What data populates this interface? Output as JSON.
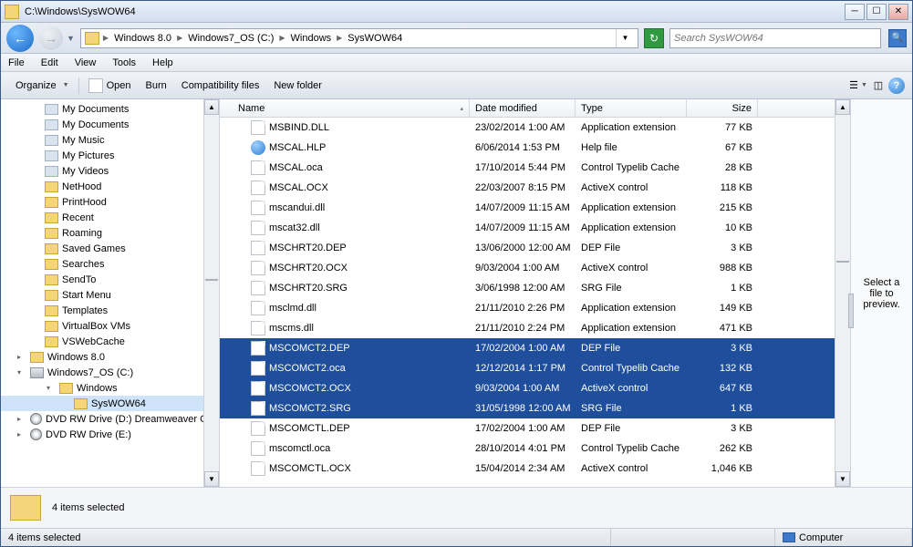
{
  "window": {
    "title": "C:\\Windows\\SysWOW64"
  },
  "breadcrumbs": [
    "Windows 8.0",
    "Windows7_OS (C:)",
    "Windows",
    "SysWOW64"
  ],
  "search": {
    "placeholder": "Search SysWOW64"
  },
  "menus": [
    "File",
    "Edit",
    "View",
    "Tools",
    "Help"
  ],
  "commandbar": {
    "organize": "Organize",
    "open": "Open",
    "burn": "Burn",
    "compat": "Compatibility files",
    "newfolder": "New folder"
  },
  "columns": {
    "name": "Name",
    "date": "Date modified",
    "type": "Type",
    "size": "Size"
  },
  "tree": [
    {
      "l": 2,
      "icon": "doc",
      "label": "My Documents"
    },
    {
      "l": 2,
      "icon": "doc",
      "label": "My Documents"
    },
    {
      "l": 2,
      "icon": "doc",
      "label": "My Music"
    },
    {
      "l": 2,
      "icon": "doc",
      "label": "My Pictures"
    },
    {
      "l": 2,
      "icon": "doc",
      "label": "My Videos"
    },
    {
      "l": 2,
      "icon": "folder",
      "label": "NetHood"
    },
    {
      "l": 2,
      "icon": "folder",
      "label": "PrintHood"
    },
    {
      "l": 2,
      "icon": "folder",
      "label": "Recent"
    },
    {
      "l": 2,
      "icon": "folder",
      "label": "Roaming"
    },
    {
      "l": 2,
      "icon": "folder",
      "label": "Saved Games"
    },
    {
      "l": 2,
      "icon": "folder",
      "label": "Searches"
    },
    {
      "l": 2,
      "icon": "folder",
      "label": "SendTo"
    },
    {
      "l": 2,
      "icon": "folder",
      "label": "Start Menu"
    },
    {
      "l": 2,
      "icon": "folder",
      "label": "Templates"
    },
    {
      "l": 2,
      "icon": "folder",
      "label": "VirtualBox VMs"
    },
    {
      "l": 2,
      "icon": "folder",
      "label": "VSWebCache"
    },
    {
      "l": 1,
      "icon": "folder",
      "label": "Windows 8.0",
      "expand": "▸"
    },
    {
      "l": 1,
      "icon": "drive",
      "label": "Windows7_OS (C:)",
      "expand": "▾"
    },
    {
      "l": 3,
      "icon": "folder",
      "label": "Windows",
      "expand": "▾"
    },
    {
      "l": 4,
      "icon": "folder",
      "label": "SysWOW64",
      "sel": true
    },
    {
      "l": 1,
      "icon": "dvd",
      "label": "DVD RW Drive (D:) Dreamweaver CS",
      "expand": "▸"
    },
    {
      "l": 1,
      "icon": "dvd",
      "label": "DVD RW Drive (E:)",
      "expand": "▸"
    }
  ],
  "files": [
    {
      "name": "MSBIND.DLL",
      "date": "23/02/2014 1:00 AM",
      "type": "Application extension",
      "size": "77 KB",
      "icon": "file"
    },
    {
      "name": "MSCAL.HLP",
      "date": "6/06/2014 1:53 PM",
      "type": "Help file",
      "size": "67 KB",
      "icon": "help"
    },
    {
      "name": "MSCAL.oca",
      "date": "17/10/2014 5:44 PM",
      "type": "Control Typelib Cache",
      "size": "28 KB",
      "icon": "file"
    },
    {
      "name": "MSCAL.OCX",
      "date": "22/03/2007 8:15 PM",
      "type": "ActiveX control",
      "size": "118 KB",
      "icon": "file"
    },
    {
      "name": "mscandui.dll",
      "date": "14/07/2009 11:15 AM",
      "type": "Application extension",
      "size": "215 KB",
      "icon": "file"
    },
    {
      "name": "mscat32.dll",
      "date": "14/07/2009 11:15 AM",
      "type": "Application extension",
      "size": "10 KB",
      "icon": "file"
    },
    {
      "name": "MSCHRT20.DEP",
      "date": "13/06/2000 12:00 AM",
      "type": "DEP File",
      "size": "3 KB",
      "icon": "file"
    },
    {
      "name": "MSCHRT20.OCX",
      "date": "9/03/2004 1:00 AM",
      "type": "ActiveX control",
      "size": "988 KB",
      "icon": "file"
    },
    {
      "name": "MSCHRT20.SRG",
      "date": "3/06/1998 12:00 AM",
      "type": "SRG File",
      "size": "1 KB",
      "icon": "file"
    },
    {
      "name": "msclmd.dll",
      "date": "21/11/2010 2:26 PM",
      "type": "Application extension",
      "size": "149 KB",
      "icon": "file"
    },
    {
      "name": "mscms.dll",
      "date": "21/11/2010 2:24 PM",
      "type": "Application extension",
      "size": "471 KB",
      "icon": "file"
    },
    {
      "name": "MSCOMCT2.DEP",
      "date": "17/02/2004 1:00 AM",
      "type": "DEP File",
      "size": "3 KB",
      "icon": "file",
      "sel": true
    },
    {
      "name": "MSCOMCT2.oca",
      "date": "12/12/2014 1:17 PM",
      "type": "Control Typelib Cache",
      "size": "132 KB",
      "icon": "file",
      "sel": true
    },
    {
      "name": "MSCOMCT2.OCX",
      "date": "9/03/2004 1:00 AM",
      "type": "ActiveX control",
      "size": "647 KB",
      "icon": "file",
      "sel": true
    },
    {
      "name": "MSCOMCT2.SRG",
      "date": "31/05/1998 12:00 AM",
      "type": "SRG File",
      "size": "1 KB",
      "icon": "file",
      "sel": true
    },
    {
      "name": "MSCOMCTL.DEP",
      "date": "17/02/2004 1:00 AM",
      "type": "DEP File",
      "size": "3 KB",
      "icon": "file"
    },
    {
      "name": "mscomctl.oca",
      "date": "28/10/2014 4:01 PM",
      "type": "Control Typelib Cache",
      "size": "262 KB",
      "icon": "file"
    },
    {
      "name": "MSCOMCTL.OCX",
      "date": "15/04/2014 2:34 AM",
      "type": "ActiveX control",
      "size": "1,046 KB",
      "icon": "file"
    }
  ],
  "preview": "Select a file to preview.",
  "details": {
    "text": "4 items selected"
  },
  "status": {
    "left": "4 items selected",
    "right": "Computer"
  }
}
